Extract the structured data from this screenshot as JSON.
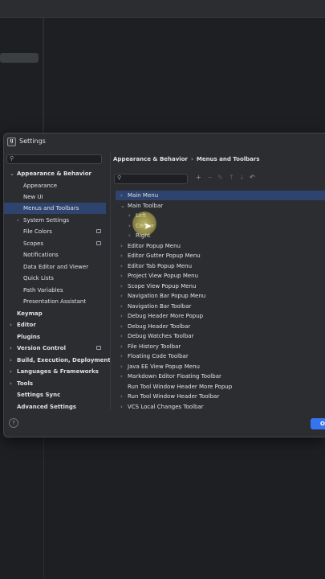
{
  "window": {
    "title": "Settings",
    "logo_letter": "IJ"
  },
  "search": {
    "glyph": "⚲"
  },
  "sidebar": {
    "items": [
      {
        "label": "Appearance & Behavior",
        "bold": true,
        "expanded": true
      },
      {
        "label": "Appearance"
      },
      {
        "label": "New UI"
      },
      {
        "label": "Menus and Toolbars",
        "selected": true
      },
      {
        "label": "System Settings",
        "has_children": true
      },
      {
        "label": "File Colors",
        "badge": true
      },
      {
        "label": "Scopes",
        "badge": true
      },
      {
        "label": "Notifications"
      },
      {
        "label": "Data Editor and Viewer"
      },
      {
        "label": "Quick Lists"
      },
      {
        "label": "Path Variables"
      },
      {
        "label": "Presentation Assistant"
      },
      {
        "label": "Keymap",
        "bold": true
      },
      {
        "label": "Editor",
        "bold": true,
        "has_children": true
      },
      {
        "label": "Plugins",
        "bold": true
      },
      {
        "label": "Version Control",
        "bold": true,
        "has_children": true,
        "badge": true
      },
      {
        "label": "Build, Execution, Deployment",
        "bold": true,
        "has_children": true
      },
      {
        "label": "Languages & Frameworks",
        "bold": true,
        "has_children": true
      },
      {
        "label": "Tools",
        "bold": true,
        "has_children": true
      },
      {
        "label": "Settings Sync",
        "bold": true
      },
      {
        "label": "Advanced Settings",
        "bold": true
      }
    ]
  },
  "breadcrumb": {
    "parent": "Appearance & Behavior",
    "current": "Menus and Toolbars",
    "separator": "›"
  },
  "toolbar": {
    "add": "+",
    "remove": "−",
    "edit": "✎",
    "move_up": "↑",
    "move_down": "↓",
    "restore": "↶"
  },
  "menus": [
    {
      "label": "Main Menu",
      "chevron": "›",
      "selected": true
    },
    {
      "label": "Main Toolbar",
      "chevron": "⌄"
    },
    {
      "label": "Left",
      "chevron": "›",
      "child": true
    },
    {
      "label": "Center",
      "chevron": "›",
      "child": true
    },
    {
      "label": "Right",
      "chevron": "›",
      "child": true
    },
    {
      "label": "Editor Popup Menu",
      "chevron": "›"
    },
    {
      "label": "Editor Gutter Popup Menu",
      "chevron": "›"
    },
    {
      "label": "Editor Tab Popup Menu",
      "chevron": "›"
    },
    {
      "label": "Project View Popup Menu",
      "chevron": "›"
    },
    {
      "label": "Scope View Popup Menu",
      "chevron": "›"
    },
    {
      "label": "Navigation Bar Popup Menu",
      "chevron": "›"
    },
    {
      "label": "Navigation Bar Toolbar",
      "chevron": "›"
    },
    {
      "label": "Debug Header More Popup",
      "chevron": "›"
    },
    {
      "label": "Debug Header Toolbar",
      "chevron": "›"
    },
    {
      "label": "Debug Watches Toolbar",
      "chevron": "›"
    },
    {
      "label": "File History Toolbar",
      "chevron": "›"
    },
    {
      "label": "Floating Code Toolbar",
      "chevron": "›"
    },
    {
      "label": "Java EE View Popup Menu",
      "chevron": "›"
    },
    {
      "label": "Markdown Editor Floating Toolbar",
      "chevron": "›"
    },
    {
      "label": "Run Tool Window Header More Popup",
      "chevron": ""
    },
    {
      "label": "Run Tool Window Header Toolbar",
      "chevron": "›"
    },
    {
      "label": "VCS Local Changes Toolbar",
      "chevron": "›"
    }
  ],
  "footer": {
    "help": "?",
    "ok": "O"
  },
  "colors": {
    "accent": "#3574f0",
    "selection": "#2e436e",
    "panel": "#2b2d30",
    "background": "#1e1f22"
  }
}
